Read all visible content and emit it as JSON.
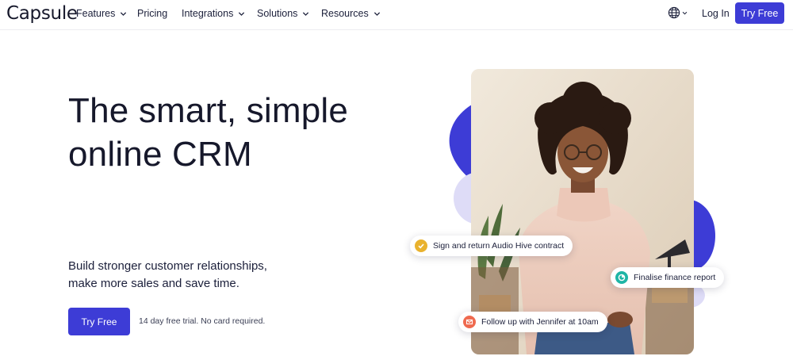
{
  "nav": {
    "logo": "Capsule",
    "items": [
      {
        "label": "Features",
        "has_dropdown": true
      },
      {
        "label": "Pricing",
        "has_dropdown": false
      },
      {
        "label": "Integrations",
        "has_dropdown": true
      },
      {
        "label": "Solutions",
        "has_dropdown": true
      },
      {
        "label": "Resources",
        "has_dropdown": true
      }
    ],
    "login_label": "Log In",
    "cta_label": "Try Free"
  },
  "hero": {
    "headline_line1": "The smart, simple",
    "headline_line2": "online CRM",
    "subline_line1": "Build stronger customer relationships,",
    "subline_line2": "make more sales and save time.",
    "cta_label": "Try Free",
    "trial_note": "14 day free trial. No card required."
  },
  "tasks": [
    {
      "label": "Sign and return Audio Hive contract",
      "icon": "check-icon",
      "color": "#e9b22e"
    },
    {
      "label": "Finalise finance report",
      "icon": "pie-chart-icon",
      "color": "#1fb5a6"
    },
    {
      "label": "Follow up with Jennifer at 10am",
      "icon": "mail-icon",
      "color": "#ef6a4f"
    }
  ],
  "colors": {
    "brand": "#3d3cd6",
    "blob_light": "#dedcf7",
    "text": "#16182b"
  }
}
